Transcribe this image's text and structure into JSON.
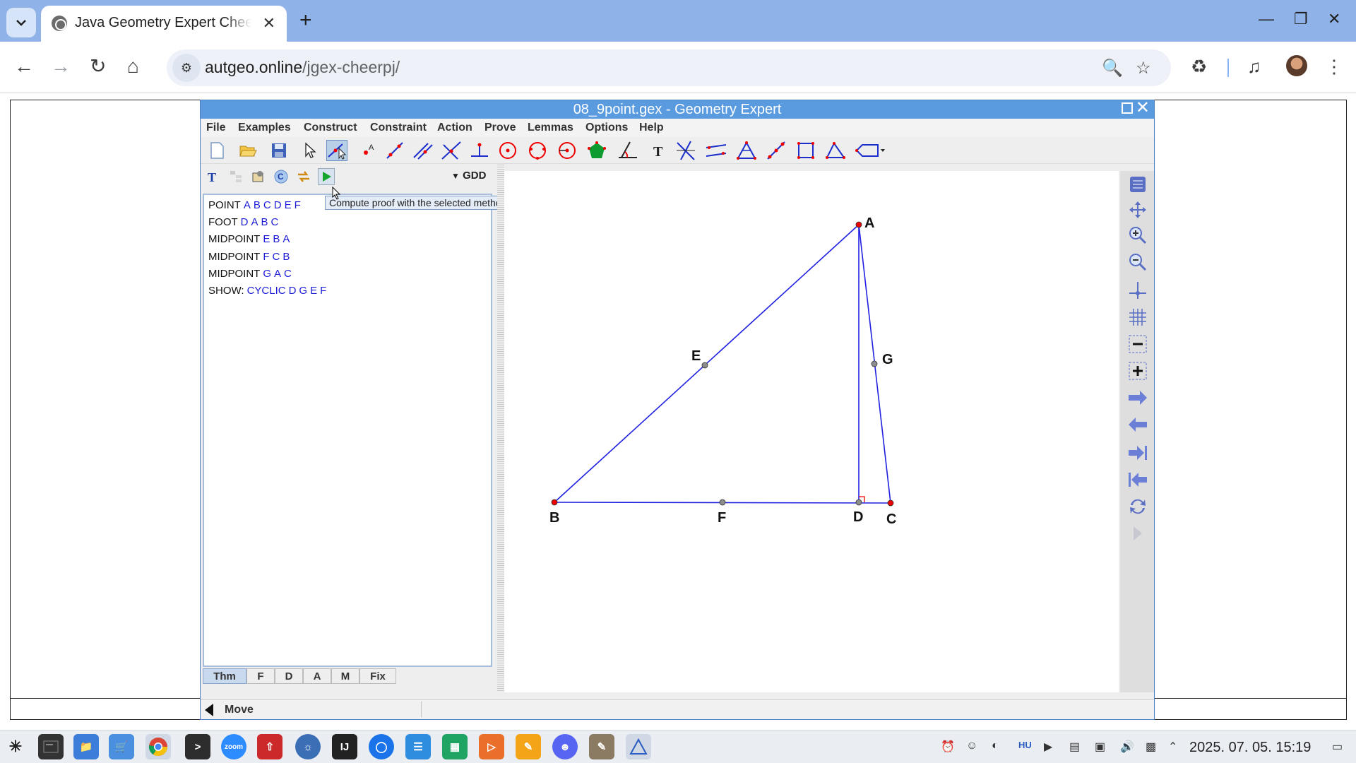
{
  "browser": {
    "tab_title": "Java Geometry Expert Cheerpj",
    "url_host": "autgeo.online",
    "url_path": "/jgex-cheerpj/",
    "new_tab_symbol": "+",
    "close_symbol": "✕",
    "minimize_symbol": "—",
    "restore_symbol": "❐",
    "window_close_symbol": "✕"
  },
  "app": {
    "title": "08_9point.gex - Geometry Expert",
    "menus": [
      "File",
      "Examples",
      "Construct",
      "Constraint",
      "Action",
      "Prove",
      "Lemmas",
      "Options",
      "Help"
    ],
    "prover_method": "GDD",
    "tooltip": "Compute proof with the selected method",
    "theorem": [
      {
        "keyword": "POINT",
        "args": [
          "A",
          "B",
          "C",
          "D",
          "E",
          "F"
        ]
      },
      {
        "keyword": "FOOT",
        "args": [
          "D",
          "A",
          "B",
          "C"
        ]
      },
      {
        "keyword": "MIDPOINT",
        "args": [
          "E",
          "B",
          "A"
        ]
      },
      {
        "keyword": "MIDPOINT",
        "args": [
          "F",
          "C",
          "B"
        ]
      },
      {
        "keyword": "MIDPOINT",
        "args": [
          "G",
          "A",
          "C"
        ]
      },
      {
        "keyword": "SHOW:",
        "args": [
          "CYCLIC",
          "D",
          "G",
          "E",
          "F"
        ]
      }
    ],
    "bottom_tabs": [
      "Thm",
      "F",
      "D",
      "A",
      "M",
      "Fix"
    ],
    "status": "Move",
    "points": {
      "A": "A",
      "B": "B",
      "C": "C",
      "D": "D",
      "E": "E",
      "F": "F",
      "G": "G"
    }
  },
  "taskbar": {
    "clock": "2025. 07. 05.  15:19",
    "lang": "HU",
    "zoom_label": "zoom"
  }
}
